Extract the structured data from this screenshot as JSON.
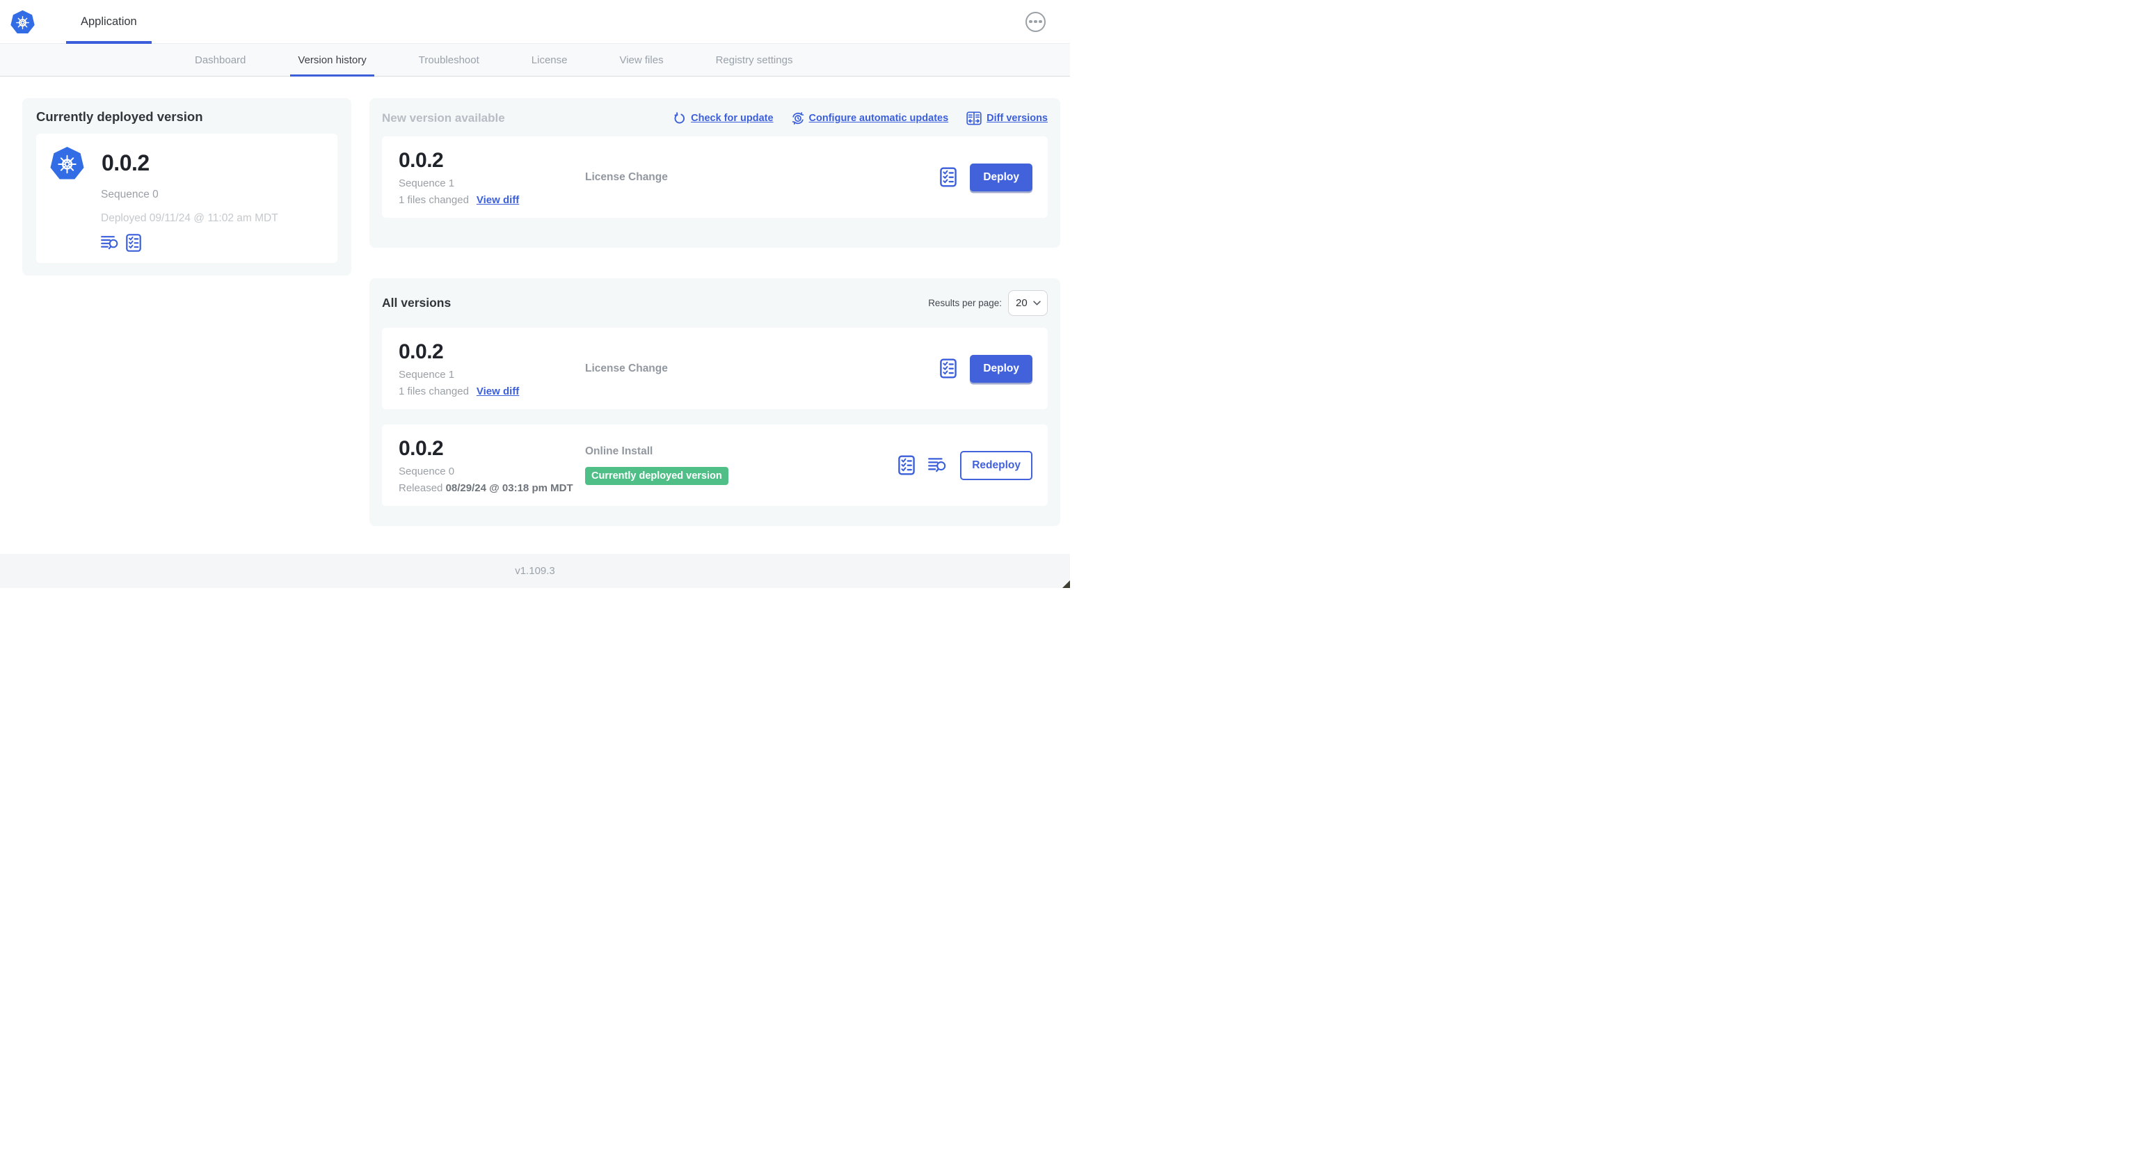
{
  "header": {
    "app_label": "Application"
  },
  "nav": {
    "tabs": [
      {
        "label": "Dashboard",
        "active": false
      },
      {
        "label": "Version history",
        "active": true
      },
      {
        "label": "Troubleshoot",
        "active": false
      },
      {
        "label": "License",
        "active": false
      },
      {
        "label": "View files",
        "active": false
      },
      {
        "label": "Registry settings",
        "active": false
      }
    ]
  },
  "current_version": {
    "title": "Currently deployed version",
    "version": "0.0.2",
    "sequence": "Sequence 0",
    "deployed": "Deployed 09/11/24 @ 11:02 am MDT"
  },
  "new_version": {
    "title": "New version available",
    "links": {
      "check_for_update": "Check for update",
      "configure_updates": "Configure automatic updates",
      "diff_versions": "Diff versions"
    },
    "card": {
      "version": "0.0.2",
      "sequence": "Sequence 1",
      "files_changed": "1 files changed",
      "view_diff_label": "View diff",
      "source": "License Change",
      "action_label": "Deploy"
    }
  },
  "all_versions": {
    "title": "All versions",
    "results_per_page_label": "Results per page:",
    "results_per_page_value": "20",
    "rows": [
      {
        "version": "0.0.2",
        "sequence": "Sequence 1",
        "files_changed": "1 files changed",
        "view_diff_label": "View diff",
        "source": "License Change",
        "action_label": "Deploy"
      },
      {
        "version": "0.0.2",
        "sequence": "Sequence 0",
        "released_prefix": "Released",
        "released_date": "08/29/24 @ 03:18 pm MDT",
        "source": "Online Install",
        "badge": "Currently deployed version",
        "action_label": "Redeploy"
      }
    ]
  },
  "footer": {
    "version": "v1.109.3"
  },
  "colors": {
    "accent": "#3B5FDB",
    "button_blue": "#4262DB",
    "badge_green": "#4FBE87",
    "logo_blue": "#326DE6"
  }
}
